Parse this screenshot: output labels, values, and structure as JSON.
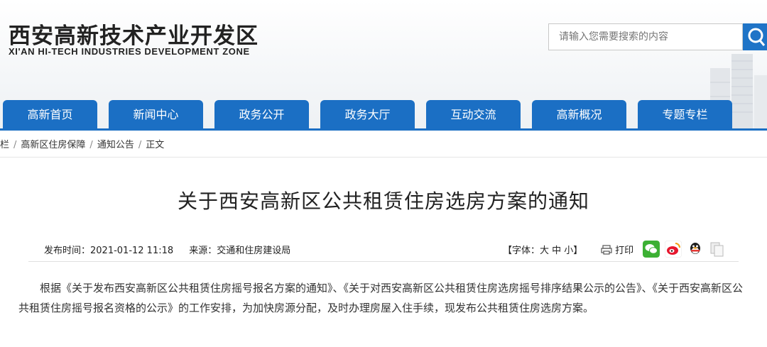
{
  "site": {
    "name_cn": "西安高新技术产业开发区",
    "name_en": "XI'AN HI-TECH INDUSTRIES DEVELOPMENT ZONE"
  },
  "search": {
    "placeholder": "请输入您需要搜索的内容",
    "icon": "search-icon"
  },
  "nav": {
    "items": [
      "高新首页",
      "新闻中心",
      "政务公开",
      "政务大厅",
      "互动交流",
      "高新概况",
      "专题专栏"
    ]
  },
  "breadcrumb": {
    "items": [
      "栏",
      "高新区住房保障",
      "通知公告",
      "正文"
    ],
    "separator": "/"
  },
  "article": {
    "title": "关于西安高新区公共租赁住房选房方案的通知",
    "publish_label": "发布时间：2021-01-12 11:18",
    "source_label": "来源：交通和住房建设局",
    "font_size_label": "【字体：大 中 小】",
    "print_label": "打印",
    "body": "根据《关于发布西安高新区公共租赁住房摇号报名方案的通知》、《关于对西安高新区公共租赁住房选房摇号排序结果公示的公告》、《关于西安高新区公共租赁住房摇号报名资格的公示》的工作安排，为加快房源分配，及时办理房屋入住手续，现发布公共租赁住房选房方案。"
  },
  "share": {
    "icons": [
      "wechat-icon",
      "weibo-icon",
      "qq-icon",
      "copy-icon"
    ]
  },
  "colors": {
    "nav": "#1b6fc4",
    "search_button": "#1f74c7"
  }
}
